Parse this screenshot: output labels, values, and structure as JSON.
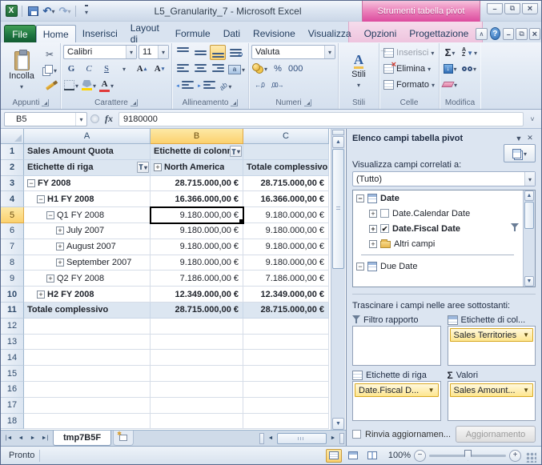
{
  "titlebar": {
    "title": "L5_Granularity_7 - Microsoft Excel",
    "contextual": "Strumenti tabella pivot"
  },
  "tabs": {
    "file": "File",
    "items": [
      "Home",
      "Inserisci",
      "Layout di",
      "Formule",
      "Dati",
      "Revisione",
      "Visualizza"
    ],
    "contextual": [
      "Opzioni",
      "Progettazione"
    ],
    "active": "Home"
  },
  "ribbon": {
    "appunti": {
      "label": "Appunti",
      "paste": "Incolla"
    },
    "carattere": {
      "label": "Carattere",
      "font_name": "Calibri",
      "font_size": "11",
      "bold": "G",
      "italic": "C",
      "underline": "S"
    },
    "allineamento": {
      "label": "Allineamento"
    },
    "numeri": {
      "label": "Numeri",
      "format": "Valuta",
      "percent": "%",
      "thousands": "000"
    },
    "stili": {
      "label": "Stili",
      "button": "Stili"
    },
    "celle": {
      "label": "Celle",
      "insert": "Inserisci",
      "delete": "Elimina",
      "format": "Formato"
    },
    "modifica": {
      "label": "Modifica",
      "autosum": "Σ"
    }
  },
  "formula_bar": {
    "name_box": "B5",
    "fx": "fx",
    "value": "9180000"
  },
  "grid": {
    "col_headers": [
      "A",
      "B",
      "C"
    ],
    "selected_cell": "B5",
    "r1": {
      "n": "1",
      "a": "Sales Amount Quota",
      "b": "Etichette di colonne",
      "c": ""
    },
    "r2": {
      "n": "2",
      "a": "Etichette di riga",
      "b": "North America",
      "c": "Totale complessivo"
    },
    "rows": [
      {
        "n": "3",
        "tog": "-",
        "ind": 0,
        "label": "FY 2008",
        "b": "28.715.000,00 €",
        "c": "28.715.000,00 €",
        "bold": true
      },
      {
        "n": "4",
        "tog": "-",
        "ind": 1,
        "label": "H1 FY 2008",
        "b": "16.366.000,00 €",
        "c": "16.366.000,00 €",
        "bold": true
      },
      {
        "n": "5",
        "tog": "-",
        "ind": 2,
        "label": "Q1 FY 2008",
        "b": "9.180.000,00 €",
        "c": "9.180.000,00 €",
        "sel": true
      },
      {
        "n": "6",
        "tog": "+",
        "ind": 3,
        "label": "July 2007",
        "b": "9.180.000,00 €",
        "c": "9.180.000,00 €"
      },
      {
        "n": "7",
        "tog": "+",
        "ind": 3,
        "label": "August 2007",
        "b": "9.180.000,00 €",
        "c": "9.180.000,00 €"
      },
      {
        "n": "8",
        "tog": "+",
        "ind": 3,
        "label": "September 2007",
        "b": "9.180.000,00 €",
        "c": "9.180.000,00 €"
      },
      {
        "n": "9",
        "tog": "+",
        "ind": 2,
        "label": "Q2 FY 2008",
        "b": "7.186.000,00 €",
        "c": "7.186.000,00 €"
      },
      {
        "n": "10",
        "tog": "+",
        "ind": 1,
        "label": "H2 FY 2008",
        "b": "12.349.000,00 €",
        "c": "12.349.000,00 €",
        "bold": true
      },
      {
        "n": "11",
        "tog": "",
        "ind": 0,
        "label": "Totale complessivo",
        "b": "28.715.000,00 €",
        "c": "28.715.000,00 €",
        "bold": true,
        "blue": true
      },
      {
        "n": "12"
      },
      {
        "n": "13"
      },
      {
        "n": "14"
      },
      {
        "n": "15"
      },
      {
        "n": "16"
      },
      {
        "n": "17"
      },
      {
        "n": "18"
      }
    ]
  },
  "field_list": {
    "title": "Elenco campi tabella pivot",
    "show_fields_label": "Visualizza campi correlati a:",
    "scope_value": "(Tutto)",
    "tree": [
      {
        "kind": "table",
        "label": "Date",
        "bold": true,
        "exp": "-"
      },
      {
        "kind": "check",
        "label": "Date.Calendar Date",
        "checked": false,
        "exp": "+"
      },
      {
        "kind": "check",
        "label": "Date.Fiscal Date",
        "checked": true,
        "bold": true,
        "exp": "+",
        "filtered": true
      },
      {
        "kind": "folder",
        "label": "Altri campi",
        "exp": "+"
      },
      {
        "kind": "sep"
      },
      {
        "kind": "table",
        "label": "Due Date",
        "exp": "-"
      }
    ],
    "drag_label": "Trascinare i campi nelle aree sottostanti:",
    "areas": {
      "filter": {
        "label": "Filtro rapporto",
        "items": []
      },
      "columns": {
        "label": "Etichette di col...",
        "items": [
          "Sales Territories"
        ]
      },
      "rows": {
        "label": "Etichette di riga",
        "items": [
          "Date.Fiscal D..."
        ]
      },
      "values": {
        "label": "Valori",
        "items": [
          "Sales Amount..."
        ]
      }
    },
    "defer_label": "Rinvia aggiornamen...",
    "update_button": "Aggiornamento"
  },
  "sheet_tabs": {
    "active": "tmp7B5F"
  },
  "status": {
    "ready": "Pronto",
    "zoom": "100%"
  }
}
